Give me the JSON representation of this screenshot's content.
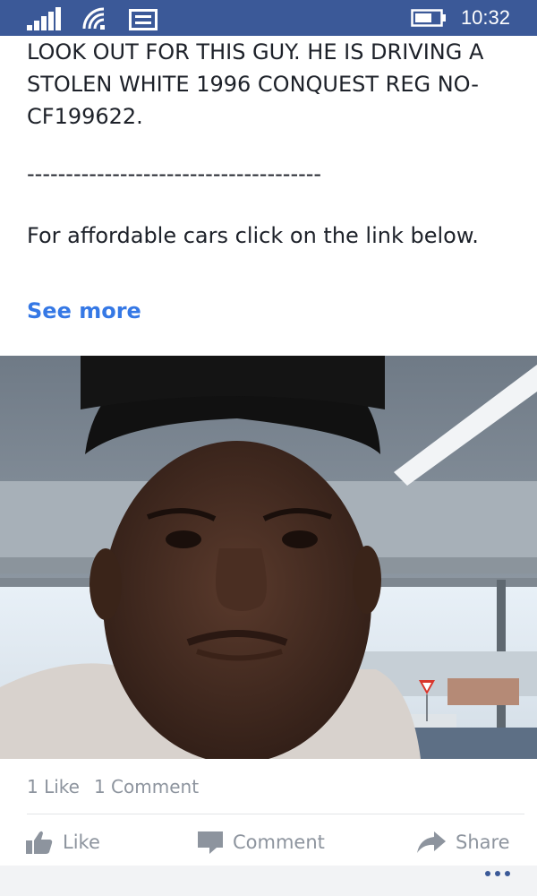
{
  "status_bar": {
    "time": "10:32",
    "icons": [
      "signal-icon",
      "wifi-icon",
      "message-icon",
      "battery-icon"
    ]
  },
  "post": {
    "text_lines": [
      "LOOK OUT FOR THIS GUY. HE IS DRIVING A",
      "STOLEN WHITE 1996 CONQUEST REG NO-",
      "CF199622."
    ],
    "divider": "--------------------------------------",
    "cta": "For affordable cars click on the link below.",
    "see_more": "See more"
  },
  "photo": {
    "road_sign_colors": [
      "#d9352b",
      "#ffffff"
    ]
  },
  "counts": {
    "likes": "1 Like",
    "comments": "1 Comment"
  },
  "actions": {
    "like": "Like",
    "comment": "Comment",
    "share": "Share"
  },
  "colors": {
    "brand": "#3b5998",
    "link": "#3578e5",
    "muted": "#8d949e"
  }
}
